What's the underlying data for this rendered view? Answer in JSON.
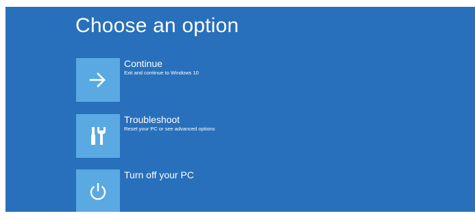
{
  "page": {
    "title": "Choose an option"
  },
  "options": [
    {
      "label": "Continue",
      "description": "Exit and continue to Windows 10",
      "icon": "arrow-right-icon"
    },
    {
      "label": "Troubleshoot",
      "description": "Reset your PC or see advanced options",
      "icon": "tools-icon"
    },
    {
      "label": "Turn off your PC",
      "description": "",
      "icon": "power-icon"
    }
  ],
  "colors": {
    "background": "#2870bb",
    "tile": "#5aa9e2",
    "text": "#ffffff"
  }
}
